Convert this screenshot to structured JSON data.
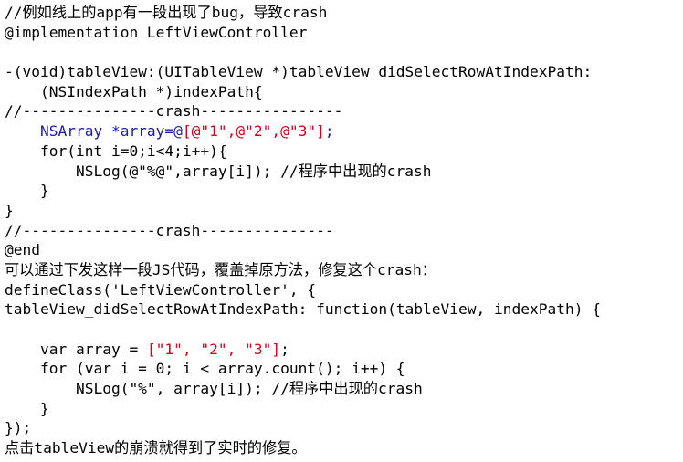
{
  "document": {
    "lines": [
      [
        {
          "t": "//例如线上的app有一段出现了bug，导致crash"
        }
      ],
      [
        {
          "t": "@implementation LeftViewController"
        }
      ],
      [
        {
          "t": ""
        }
      ],
      [
        {
          "t": "-(void)tableView:(UITableView *)tableView didSelectRowAtIndexPath:"
        }
      ],
      [
        {
          "t": "    (NSIndexPath *)indexPath{"
        }
      ],
      [
        {
          "t": "//---------------crash----------------"
        }
      ],
      [
        {
          "t": "    NSArray *array=@",
          "c": "blue"
        },
        {
          "t": "[@\"1\",@\"2\",@\"3\"]",
          "c": "red"
        },
        {
          "t": ";",
          "c": "blue"
        }
      ],
      [
        {
          "t": "    for(int i=0;i<4;i++){"
        }
      ],
      [
        {
          "t": "        NSLog(@\"%@\",array[i]); //程序中出现的crash"
        }
      ],
      [
        {
          "t": "    }"
        }
      ],
      [
        {
          "t": "}"
        }
      ],
      [
        {
          "t": "//---------------crash---------------"
        }
      ],
      [
        {
          "t": "@end"
        }
      ],
      [
        {
          "t": "可以通过下发这样一段JS代码，覆盖掉原方法，修复这个crash："
        }
      ],
      [
        {
          "t": "defineClass('LeftViewController', {"
        }
      ],
      [
        {
          "t": "tableView_didSelectRowAtIndexPath: function(tableView, indexPath) {"
        }
      ],
      [
        {
          "t": ""
        }
      ],
      [
        {
          "t": "    var array = "
        },
        {
          "t": "[\"1\", \"2\", \"3\"]",
          "c": "red"
        },
        {
          "t": ";"
        }
      ],
      [
        {
          "t": "    for (var i = 0; i < array.count(); i++) {"
        }
      ],
      [
        {
          "t": "        NSLog(\"%\", array[i]); //程序中出现的crash"
        }
      ],
      [
        {
          "t": "    }"
        }
      ],
      [
        {
          "t": "});"
        }
      ],
      [
        {
          "t": "点击tableView的崩溃就得到了实时的修复。"
        }
      ]
    ]
  },
  "colors": {
    "text": "#000000",
    "red": "#d0021b",
    "blue": "#1a1aa6",
    "background": "#ffffff"
  }
}
